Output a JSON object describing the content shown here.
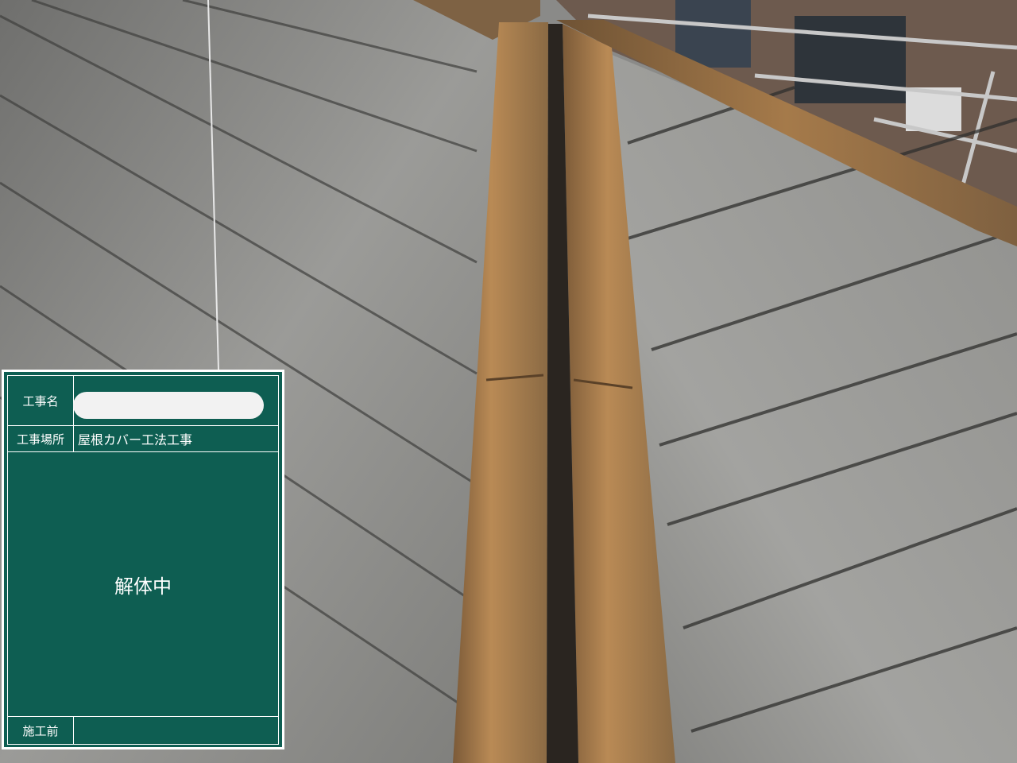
{
  "colors": {
    "board_green": "#0e5e52",
    "board_line": "#ffffff",
    "slate": "#8e8e8c",
    "wood": "#a8794a"
  },
  "signboard": {
    "project_name_label": "工事名",
    "project_name_value": "",
    "site_label": "工事場所",
    "site_value": "屋根カバー工法工事",
    "main_text": "解体中",
    "status_label": "施工前",
    "status_value": ""
  }
}
